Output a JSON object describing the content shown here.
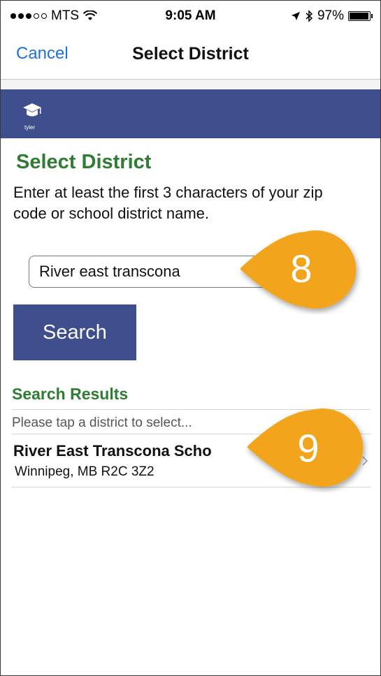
{
  "status_bar": {
    "carrier": "MTS",
    "time": "9:05 AM",
    "battery": "97%",
    "battery_level": 0.97
  },
  "nav": {
    "cancel_label": "Cancel",
    "title": "Select District"
  },
  "brand": {
    "logo_text": "tyler"
  },
  "content": {
    "heading": "Select District",
    "instructions": "Enter at least the first 3 characters of your zip code or school district name.",
    "search_value": "River east transcona",
    "search_button_label": "Search"
  },
  "results": {
    "title": "Search Results",
    "hint": "Please tap a district to select...",
    "items": [
      {
        "name": "River East Transcona Scho",
        "address": "Winnipeg, MB R2C 3Z2"
      }
    ]
  },
  "callouts": {
    "first": "8",
    "second": "9",
    "color": "#f2a51c"
  },
  "colors": {
    "brand": "#3f4f8d",
    "heading_green": "#2e7d32",
    "link_blue": "#1f6fe0"
  }
}
